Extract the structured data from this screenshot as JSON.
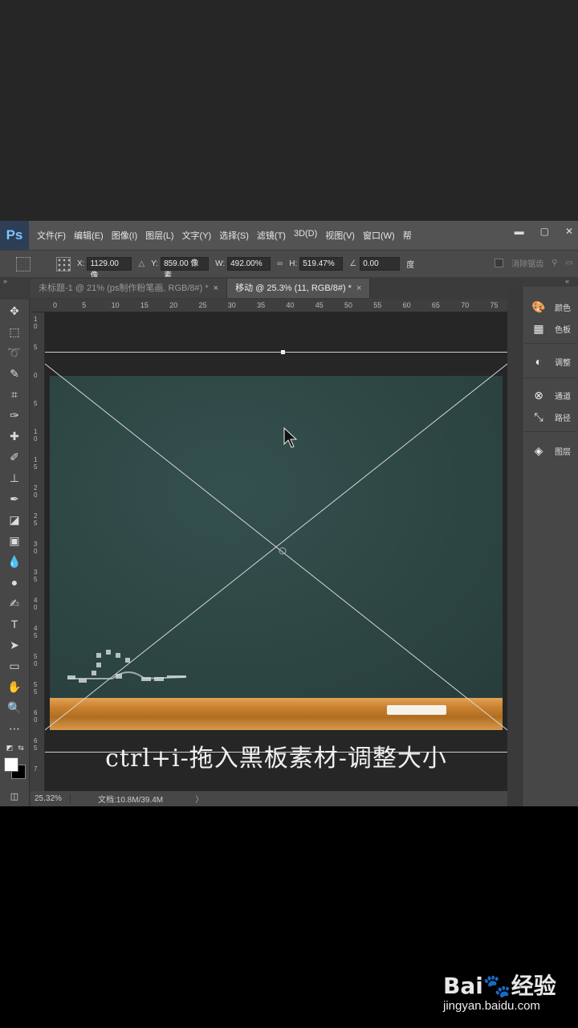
{
  "app": {
    "logo": "Ps"
  },
  "menu": [
    "文件(F)",
    "编辑(E)",
    "图像(I)",
    "图层(L)",
    "文字(Y)",
    "选择(S)",
    "滤镜(T)",
    "3D(D)",
    "视图(V)",
    "窗口(W)",
    "帮"
  ],
  "options": {
    "x_label": "X:",
    "x_value": "1129.00 像",
    "y_label": "Y:",
    "y_value": "859.00 像素",
    "w_label": "W:",
    "w_value": "492.00%",
    "h_label": "H:",
    "h_value": "519.47%",
    "angle_value": "0.00",
    "angle_unit": "度",
    "commit_label": "消除锯齿"
  },
  "tabs": [
    {
      "label": "未标题-1 @ 21% (ps制作粉笔画, RGB/8#) *",
      "active": false
    },
    {
      "label": "移动 @ 25.3% (11, RGB/8#) *",
      "active": true
    }
  ],
  "ruler_h": [
    "0",
    "5",
    "10",
    "15",
    "20",
    "25",
    "30",
    "35",
    "40",
    "45",
    "50",
    "55",
    "60",
    "65",
    "70",
    "75"
  ],
  "ruler_v": [
    "1\n0",
    "5",
    "0",
    "5",
    "1\n0",
    "1\n5",
    "2\n0",
    "2\n5",
    "3\n0",
    "3\n5",
    "4\n0",
    "4\n5",
    "5\n0",
    "5\n5",
    "6\n0",
    "6\n5",
    "7"
  ],
  "canvas": {
    "caption": "ctrl+i-拖入黑板素材-调整大小"
  },
  "status": {
    "zoom": "25.32%",
    "doc": "文档:10.8M/39.4M",
    "arrow": "〉"
  },
  "right_panel": [
    {
      "icon": "palette-icon",
      "glyph": "🎨",
      "label": "颜色"
    },
    {
      "icon": "swatches-icon",
      "glyph": "▦",
      "label": "色板"
    },
    {
      "icon": "adjustments-icon",
      "glyph": "◐",
      "label": "调整"
    },
    {
      "icon": "channels-icon",
      "glyph": "⊗",
      "label": "通道"
    },
    {
      "icon": "paths-icon",
      "glyph": "⤡",
      "label": "路径"
    },
    {
      "icon": "layers-icon",
      "glyph": "◈",
      "label": "图层"
    }
  ],
  "watermark": {
    "logo": "Bai🐾经验",
    "url": "jingyan.baidu.com"
  }
}
